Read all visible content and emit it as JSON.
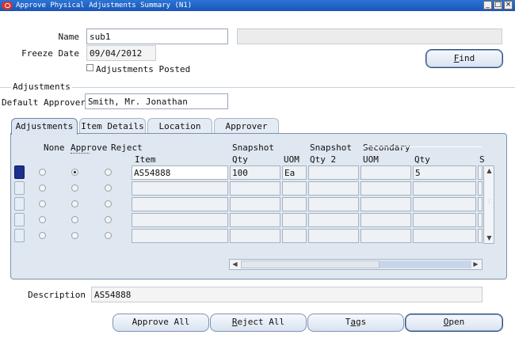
{
  "window": {
    "title": "Approve Physical Adjustments Summary (N1)",
    "controls": {
      "minimize": "_",
      "maximize": "□",
      "close": "×"
    }
  },
  "header": {
    "name_label": "Name",
    "name_value": "sub1",
    "name_desc_value": "",
    "freeze_date_label": "Freeze Date",
    "freeze_date_value": "09/04/2012",
    "adjustments_posted_label": "Adjustments Posted",
    "adjustments_posted_checked": false,
    "find_button": "Find"
  },
  "adjustments_section": {
    "title": "Adjustments",
    "default_approver_label": "Default Approver",
    "default_approver_value": "Smith, Mr. Jonathan"
  },
  "tabs": [
    {
      "label": "Adjustments",
      "active": true
    },
    {
      "label": "Item Details",
      "active": false
    },
    {
      "label": "Location",
      "active": false
    },
    {
      "label": "Approver",
      "active": false
    }
  ],
  "table": {
    "headers": {
      "none": "None",
      "approve": "Approve",
      "reject": "Reject",
      "item": "Item",
      "snapshot_qty_top": "Snapshot",
      "snapshot_qty": "Qty",
      "uom": "UOM",
      "snapshot_qty2_top": "Snapshot",
      "snapshot_qty2": "Qty 2",
      "secondary_top": "Secondary",
      "secondary_uom": "UOM",
      "secondary_qty": "Qty",
      "truncated": "S"
    },
    "rows": [
      {
        "item": "AS54888",
        "qty": "100",
        "uom": "Ea",
        "qty2": "",
        "sec_uom": "",
        "sec_qty": "5",
        "selected": "approve"
      },
      {
        "item": "",
        "qty": "",
        "uom": "",
        "qty2": "",
        "sec_uom": "",
        "sec_qty": "",
        "selected": ""
      },
      {
        "item": "",
        "qty": "",
        "uom": "",
        "qty2": "",
        "sec_uom": "",
        "sec_qty": "",
        "selected": ""
      },
      {
        "item": "",
        "qty": "",
        "uom": "",
        "qty2": "",
        "sec_uom": "",
        "sec_qty": "",
        "selected": ""
      },
      {
        "item": "",
        "qty": "",
        "uom": "",
        "qty2": "",
        "sec_uom": "",
        "sec_qty": "",
        "selected": ""
      }
    ]
  },
  "footer": {
    "description_label": "Description",
    "description_value": "AS54888",
    "buttons": {
      "approve_all": "Approve All",
      "reject_all": "Reject All",
      "tags": "Tags",
      "open": "Open"
    }
  },
  "colors": {
    "titlebar": "#1b56b6",
    "panel": "#dfe7f0",
    "row_indicator": "#1b2f8f"
  }
}
